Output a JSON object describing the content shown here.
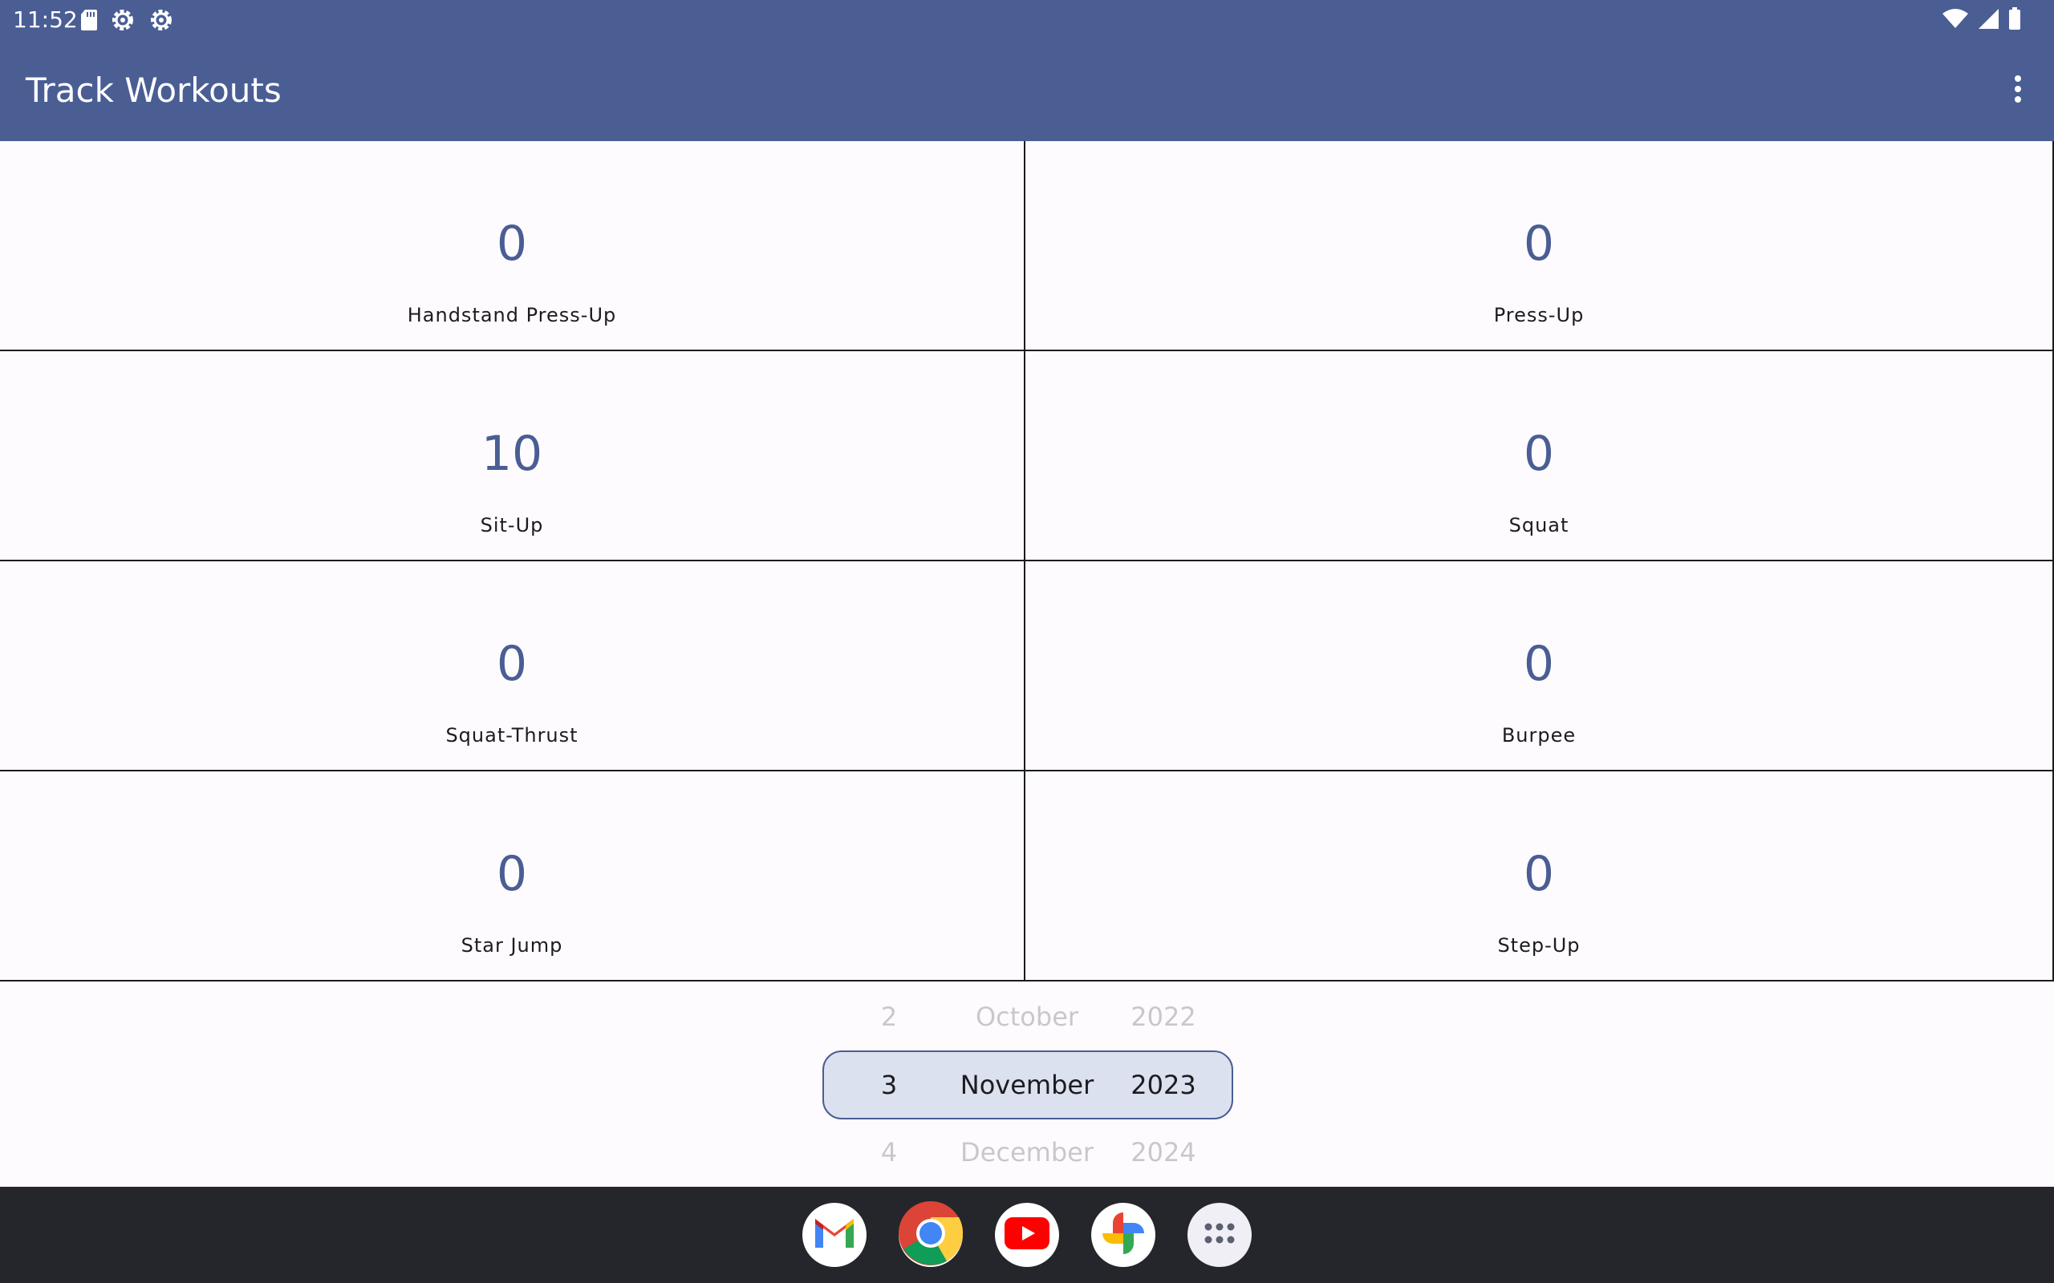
{
  "status_bar": {
    "time": "11:52",
    "left_icons": [
      "sd-card-icon",
      "settings-gear-icon",
      "settings-gear-icon"
    ],
    "right_icons": [
      "wifi-icon",
      "cell-signal-icon",
      "battery-icon"
    ]
  },
  "app_bar": {
    "title": "Track Workouts",
    "menu_icon": "more-vert-icon"
  },
  "workouts": [
    {
      "count": "0",
      "name": "Handstand Press-Up"
    },
    {
      "count": "0",
      "name": "Press-Up"
    },
    {
      "count": "10",
      "name": "Sit-Up"
    },
    {
      "count": "0",
      "name": "Squat"
    },
    {
      "count": "0",
      "name": "Squat-Thrust"
    },
    {
      "count": "0",
      "name": "Burpee"
    },
    {
      "count": "0",
      "name": "Star Jump"
    },
    {
      "count": "0",
      "name": "Step-Up"
    }
  ],
  "date_picker": {
    "day": {
      "prev": "2",
      "current": "3",
      "next": "4"
    },
    "month": {
      "prev": "October",
      "current": "November",
      "next": "December"
    },
    "year": {
      "prev": "2022",
      "current": "2023",
      "next": "2024"
    }
  },
  "dock": {
    "apps": [
      "gmail-icon",
      "chrome-icon",
      "youtube-icon",
      "photos-icon",
      "app-drawer-icon"
    ]
  },
  "colors": {
    "primary": "#4a5e94",
    "background": "#fefbff",
    "dock": "#25262b"
  }
}
